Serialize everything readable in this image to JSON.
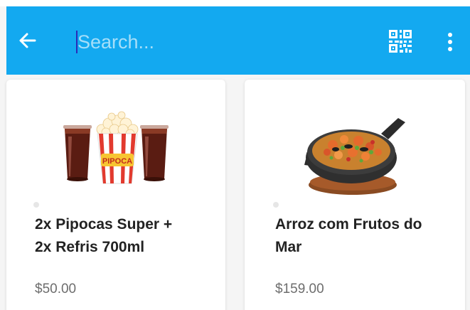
{
  "colors": {
    "appbar": "#13a9f0",
    "title_text": "#222222",
    "price_text": "#6d6d6d"
  },
  "header": {
    "back_icon": "arrow-left-icon",
    "search_placeholder": "Search...",
    "search_value": "",
    "qr_icon": "qr-code-scan-icon",
    "more_icon": "more-vertical-icon"
  },
  "products": [
    {
      "image": "popcorn-and-sodas-image",
      "popcorn_bucket_label": "PIPOCA",
      "name_line1": "2x Pipocas Super +",
      "name_line2": "2x Refris 700ml",
      "price": "$50.00"
    },
    {
      "image": "seafood-rice-pan-image",
      "name_line1": "Arroz com Frutos do",
      "name_line2": "Mar",
      "price": "$159.00"
    }
  ]
}
